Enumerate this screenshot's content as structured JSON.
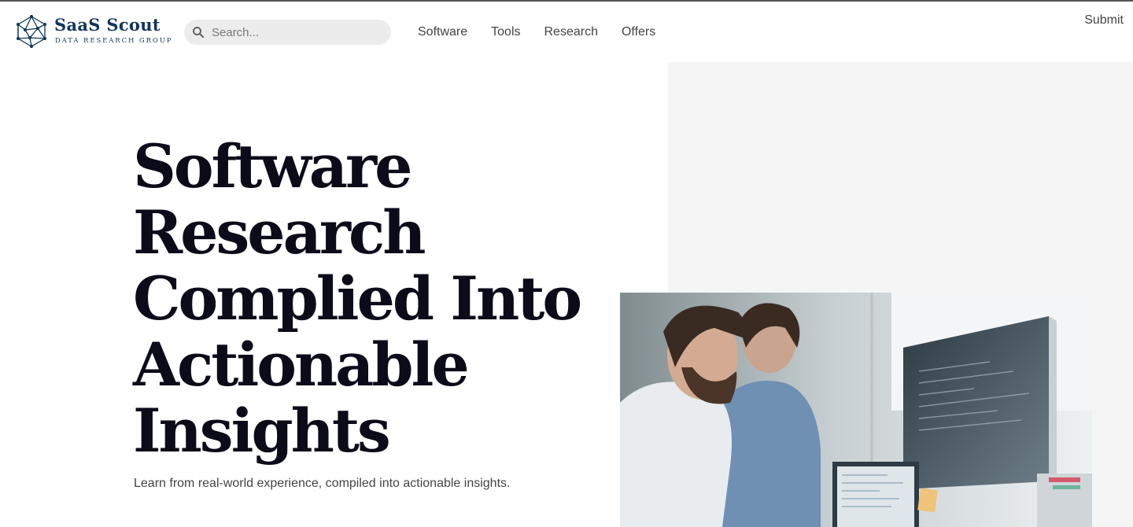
{
  "brand": {
    "name": "SaaS Scout",
    "tagline": "DATA RESEARCH GROUP",
    "logo_icon": "network-globe-icon",
    "color": "#12355b"
  },
  "search": {
    "placeholder": "Search...",
    "value": "",
    "icon": "search-icon"
  },
  "nav": {
    "items": [
      {
        "label": "Software"
      },
      {
        "label": "Tools"
      },
      {
        "label": "Research"
      },
      {
        "label": "Offers"
      }
    ]
  },
  "header": {
    "submit_label": "Submit"
  },
  "hero": {
    "headline_lines": [
      "Software",
      "Research",
      "Complied Into",
      "Actionable",
      "Insights"
    ],
    "subtext": "Learn from real-world experience, compiled into actionable insights.",
    "image_alt": "Two people looking at computer monitors in an office"
  },
  "colors": {
    "headline": "#0b0b1a",
    "panel": "#f5f5f5",
    "search_bg": "#ececec"
  }
}
